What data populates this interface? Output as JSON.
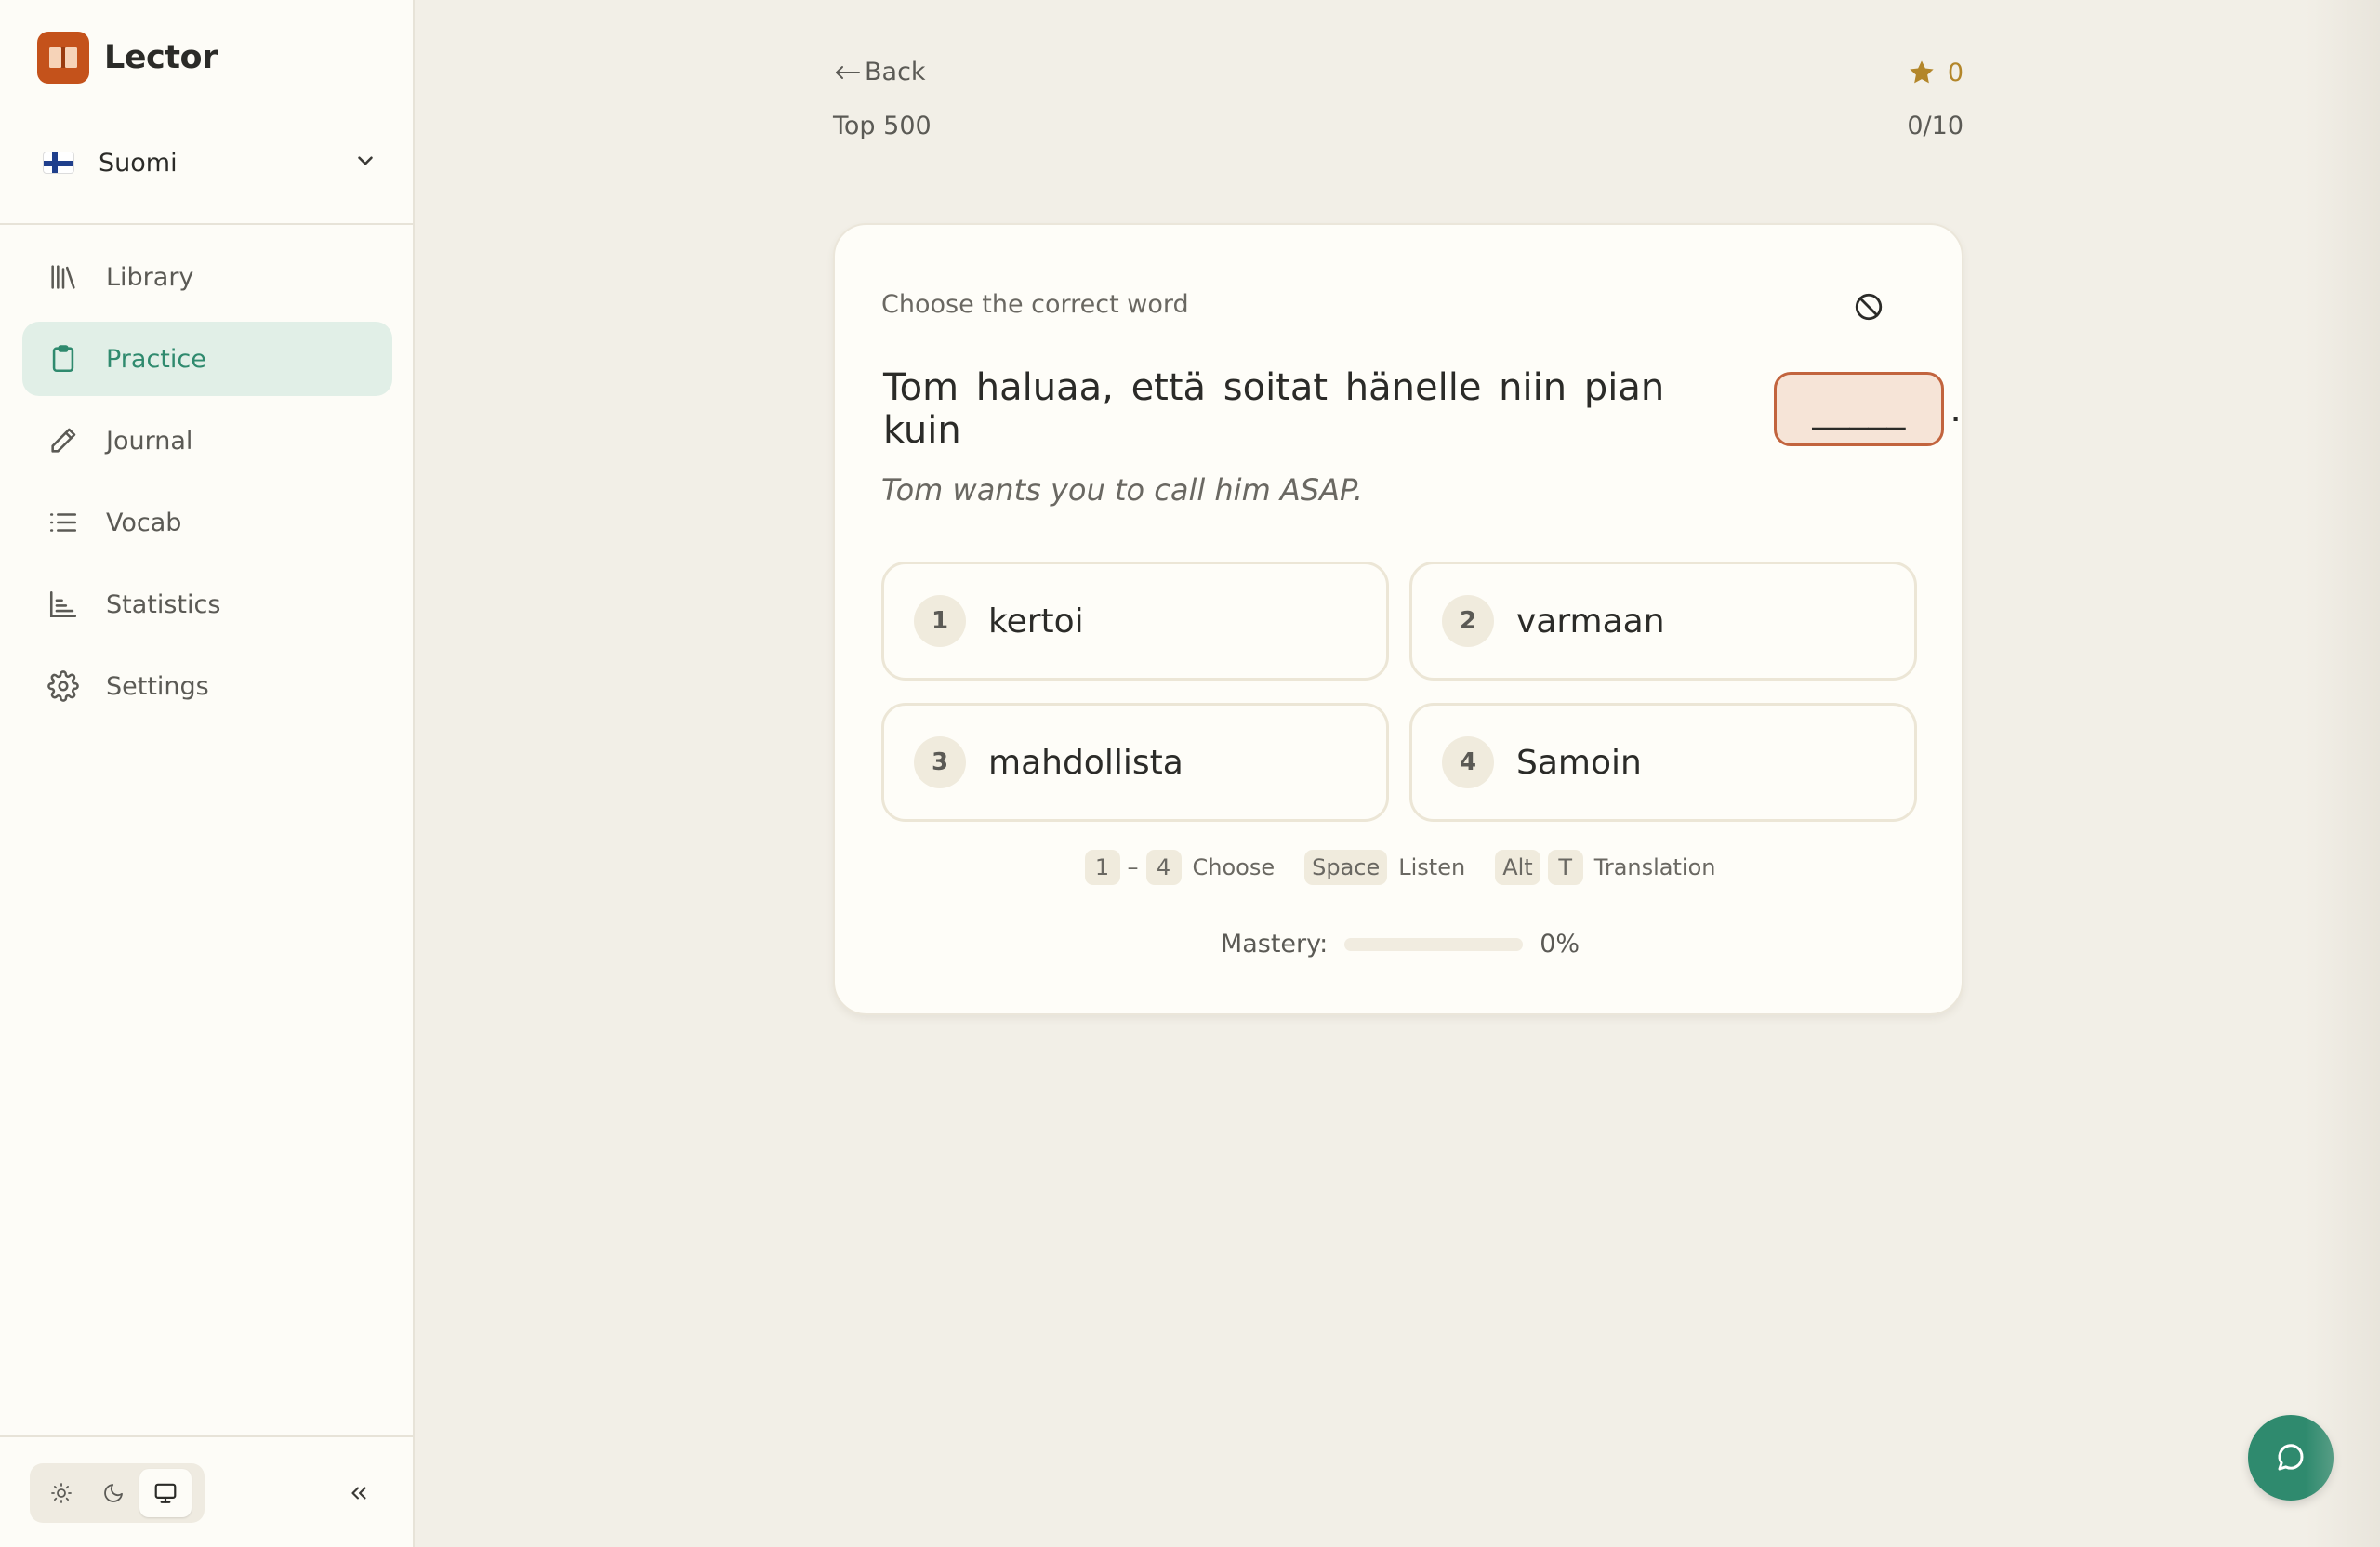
{
  "app": {
    "name": "Lector"
  },
  "language": {
    "name": "Suomi"
  },
  "nav": {
    "items": [
      {
        "label": "Library"
      },
      {
        "label": "Practice"
      },
      {
        "label": "Journal"
      },
      {
        "label": "Vocab"
      },
      {
        "label": "Statistics"
      },
      {
        "label": "Settings"
      }
    ],
    "active": "Practice"
  },
  "header": {
    "back_label": "Back",
    "deck_name": "Top 500",
    "score": "0",
    "progress": "0/10"
  },
  "exercise": {
    "prompt": "Choose the correct word",
    "sentence": "Tom haluaa, että soitat hänelle niin pian kuin",
    "blank": "_____",
    "period": ".",
    "translation": "Tom wants you to call him ASAP.",
    "options": [
      {
        "number": "1",
        "label": "kertoi"
      },
      {
        "number": "2",
        "label": "varmaan"
      },
      {
        "number": "3",
        "label": "mahdollista"
      },
      {
        "number": "4",
        "label": "Samoin"
      }
    ]
  },
  "hints": {
    "range_start": "1",
    "range_sep": "–",
    "range_end": "4",
    "choose": "Choose",
    "space_key": "Space",
    "listen": "Listen",
    "alt_key": "Alt",
    "t_key": "T",
    "translation": "Translation"
  },
  "mastery": {
    "label": "Mastery:",
    "value": "0%",
    "fraction": 0
  },
  "colors": {
    "accent": "#2f8a6e",
    "brand": "#c4521b",
    "star": "#b3862a",
    "blank_border": "#c2643e"
  }
}
